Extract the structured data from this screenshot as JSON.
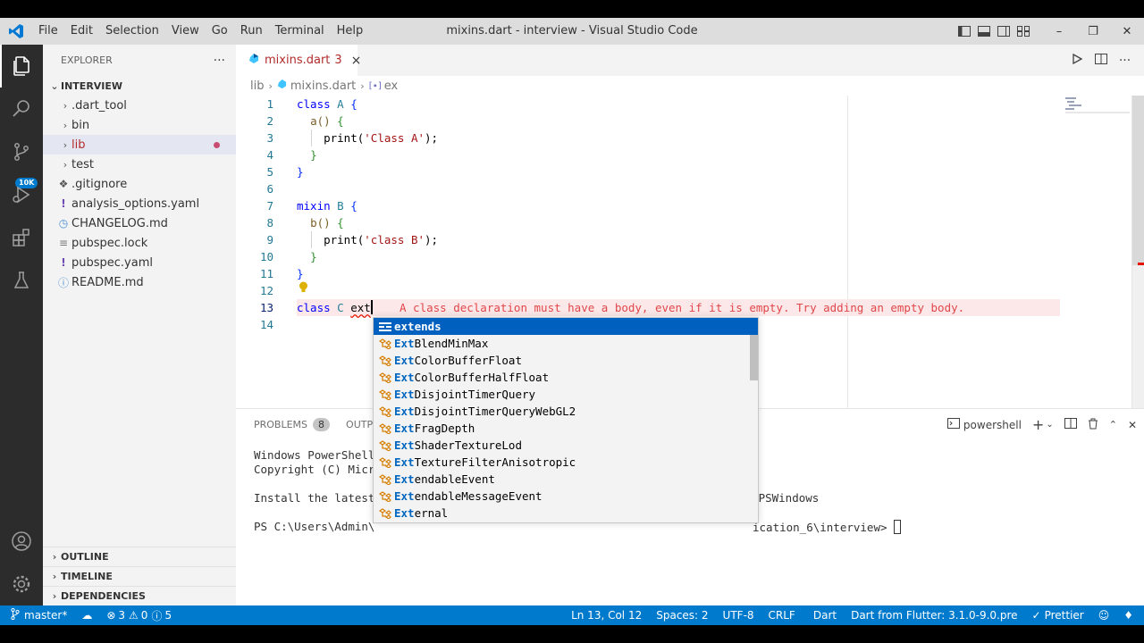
{
  "window": {
    "title": "mixins.dart - interview - Visual Studio Code"
  },
  "menu": [
    "File",
    "Edit",
    "Selection",
    "View",
    "Go",
    "Run",
    "Terminal",
    "Help"
  ],
  "activity": {
    "scm_badge": "10K"
  },
  "explorer": {
    "header": "EXPLORER",
    "more": "···",
    "workspace": "INTERVIEW",
    "items": [
      {
        "label": ".dart_tool"
      },
      {
        "label": "bin"
      },
      {
        "label": "lib"
      },
      {
        "label": "test"
      },
      {
        "label": ".gitignore"
      },
      {
        "label": "analysis_options.yaml"
      },
      {
        "label": "CHANGELOG.md"
      },
      {
        "label": "pubspec.lock"
      },
      {
        "label": "pubspec.yaml"
      },
      {
        "label": "README.md"
      }
    ],
    "sections": [
      "OUTLINE",
      "TIMELINE",
      "DEPENDENCIES"
    ]
  },
  "tab": {
    "name": "mixins.dart",
    "problems": "3",
    "close": "×"
  },
  "breadcrumb": {
    "folder": "lib",
    "file": "mixins.dart",
    "symbol": "ex"
  },
  "line_numbers": [
    "1",
    "2",
    "3",
    "4",
    "5",
    "6",
    "7",
    "8",
    "9",
    "10",
    "11",
    "12",
    "13",
    "14"
  ],
  "code": {
    "l1_kw": "class",
    "l1_name": "A",
    "l1_brace": "{",
    "l2_fn": "a()",
    "l2_brace": "{",
    "l3_fn": "print(",
    "l3_str": "'Class A'",
    "l3_end": ");",
    "l4": "}",
    "l5": "}",
    "l7_kw": "mixin",
    "l7_name": "B",
    "l7_brace": "{",
    "l8_fn": "b()",
    "l8_brace": "{",
    "l9_fn": "print(",
    "l9_str": "'class B'",
    "l9_end": ");",
    "l10": "}",
    "l11": "}",
    "l13_kw": "class",
    "l13_name": "C",
    "l13_typed": "ext"
  },
  "error_message": "A class declaration must have a body, even if it is empty. Try adding an empty body.",
  "suggestions": [
    {
      "hl": "",
      "rest": "extends",
      "full_hl": "extends",
      "kind": "keyword"
    },
    {
      "hl": "Ext",
      "rest": "BlendMinMax",
      "kind": "class"
    },
    {
      "hl": "Ext",
      "rest": "ColorBufferFloat",
      "kind": "class"
    },
    {
      "hl": "Ext",
      "rest": "ColorBufferHalfFloat",
      "kind": "class"
    },
    {
      "hl": "Ext",
      "rest": "DisjointTimerQuery",
      "kind": "class"
    },
    {
      "hl": "Ext",
      "rest": "DisjointTimerQueryWebGL2",
      "kind": "class"
    },
    {
      "hl": "Ext",
      "rest": "FragDepth",
      "kind": "class"
    },
    {
      "hl": "Ext",
      "rest": "ShaderTextureLod",
      "kind": "class"
    },
    {
      "hl": "Ext",
      "rest": "TextureFilterAnisotropic",
      "kind": "class"
    },
    {
      "hl": "Ext",
      "rest": "endableEvent",
      "kind": "class"
    },
    {
      "hl": "Ext",
      "rest": "endableMessageEvent",
      "kind": "class"
    },
    {
      "hl": "Ext",
      "rest": "ernal",
      "kind": "class"
    }
  ],
  "panel": {
    "problems_label": "PROBLEMS",
    "problems_count": "8",
    "output_label": "OUTPUT",
    "terminal_name": "powershell",
    "terminal_lines": [
      "Windows PowerShell",
      "Copyright (C) Micr",
      "",
      "Install the latest",
      "",
      "PS C:\\Users\\Admin\\"
    ],
    "terminal_tail_3": "ms/PSWindows",
    "terminal_tail_5": "ication_6\\interview>"
  },
  "status": {
    "branch": "master*",
    "errors": "3",
    "warnings": "0",
    "infos": "5",
    "position": "Ln 13, Col 12",
    "spaces": "Spaces: 2",
    "encoding": "UTF-8",
    "eol": "CRLF",
    "language": "Dart",
    "sdk": "Dart from Flutter: 3.1.0-9.0.pre",
    "prettier": "Prettier"
  },
  "colors": {
    "accent": "#007acc",
    "error": "#e51400",
    "selection": "#0060c0"
  }
}
